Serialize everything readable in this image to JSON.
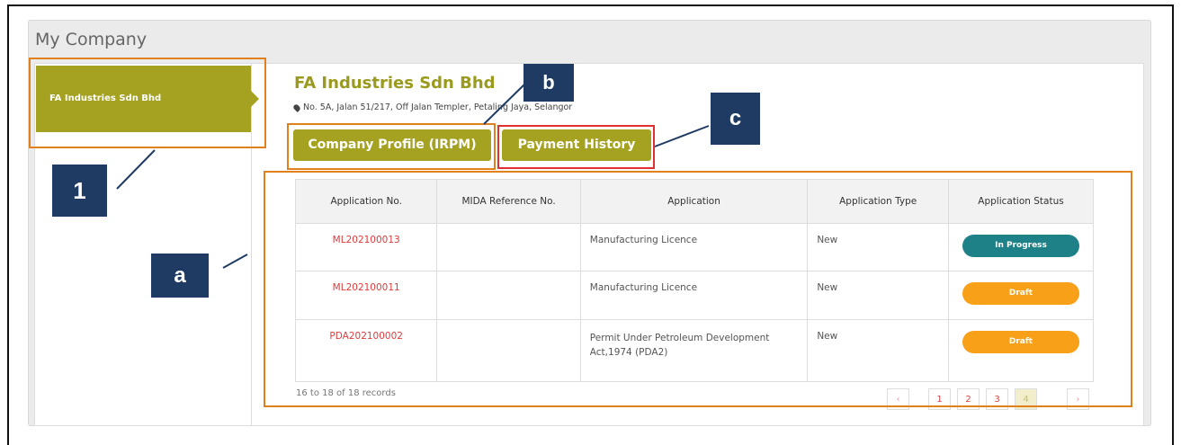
{
  "panel": {
    "title": "My Company"
  },
  "sidebar": {
    "company_item": "FA Industries Sdn Bhd"
  },
  "company": {
    "name": "FA Industries Sdn Bhd",
    "address": "No. 5A, Jalan 51/217, Off Jalan Templer, Petaling Jaya, Selangor"
  },
  "buttons": {
    "company_profile": "Company Profile (IRPM)",
    "payment_history": "Payment History"
  },
  "callouts": {
    "c1": "1",
    "ca": "a",
    "cb": "b",
    "cc": "c"
  },
  "table": {
    "headers": [
      "Application No.",
      "MIDA Reference No.",
      "Application",
      "Application Type",
      "Application Status"
    ],
    "rows": [
      {
        "app_no": "ML202100013",
        "mida_ref": "",
        "application": "Manufacturing Licence",
        "type": "New",
        "status": "In Progress"
      },
      {
        "app_no": "ML202100011",
        "mida_ref": "",
        "application": "Manufacturing Licence",
        "type": "New",
        "status": "Draft"
      },
      {
        "app_no": "PDA202100002",
        "mida_ref": "",
        "application": "Permit Under Petroleum Development Act,1974 (PDA2)",
        "type": "New",
        "status": "Draft"
      }
    ]
  },
  "footer": {
    "records": "16 to 18 of 18 records"
  },
  "pagination": {
    "prev": "‹",
    "pages": [
      "1",
      "2",
      "3",
      "4"
    ],
    "next": "›",
    "current": "4"
  },
  "colors": {
    "brand": "#a4a220",
    "callout": "#1f3b63",
    "highlight_orange": "#e0811e",
    "highlight_red": "#e03030",
    "status_in_progress": "#1d8187",
    "status_draft": "#f7a018"
  }
}
